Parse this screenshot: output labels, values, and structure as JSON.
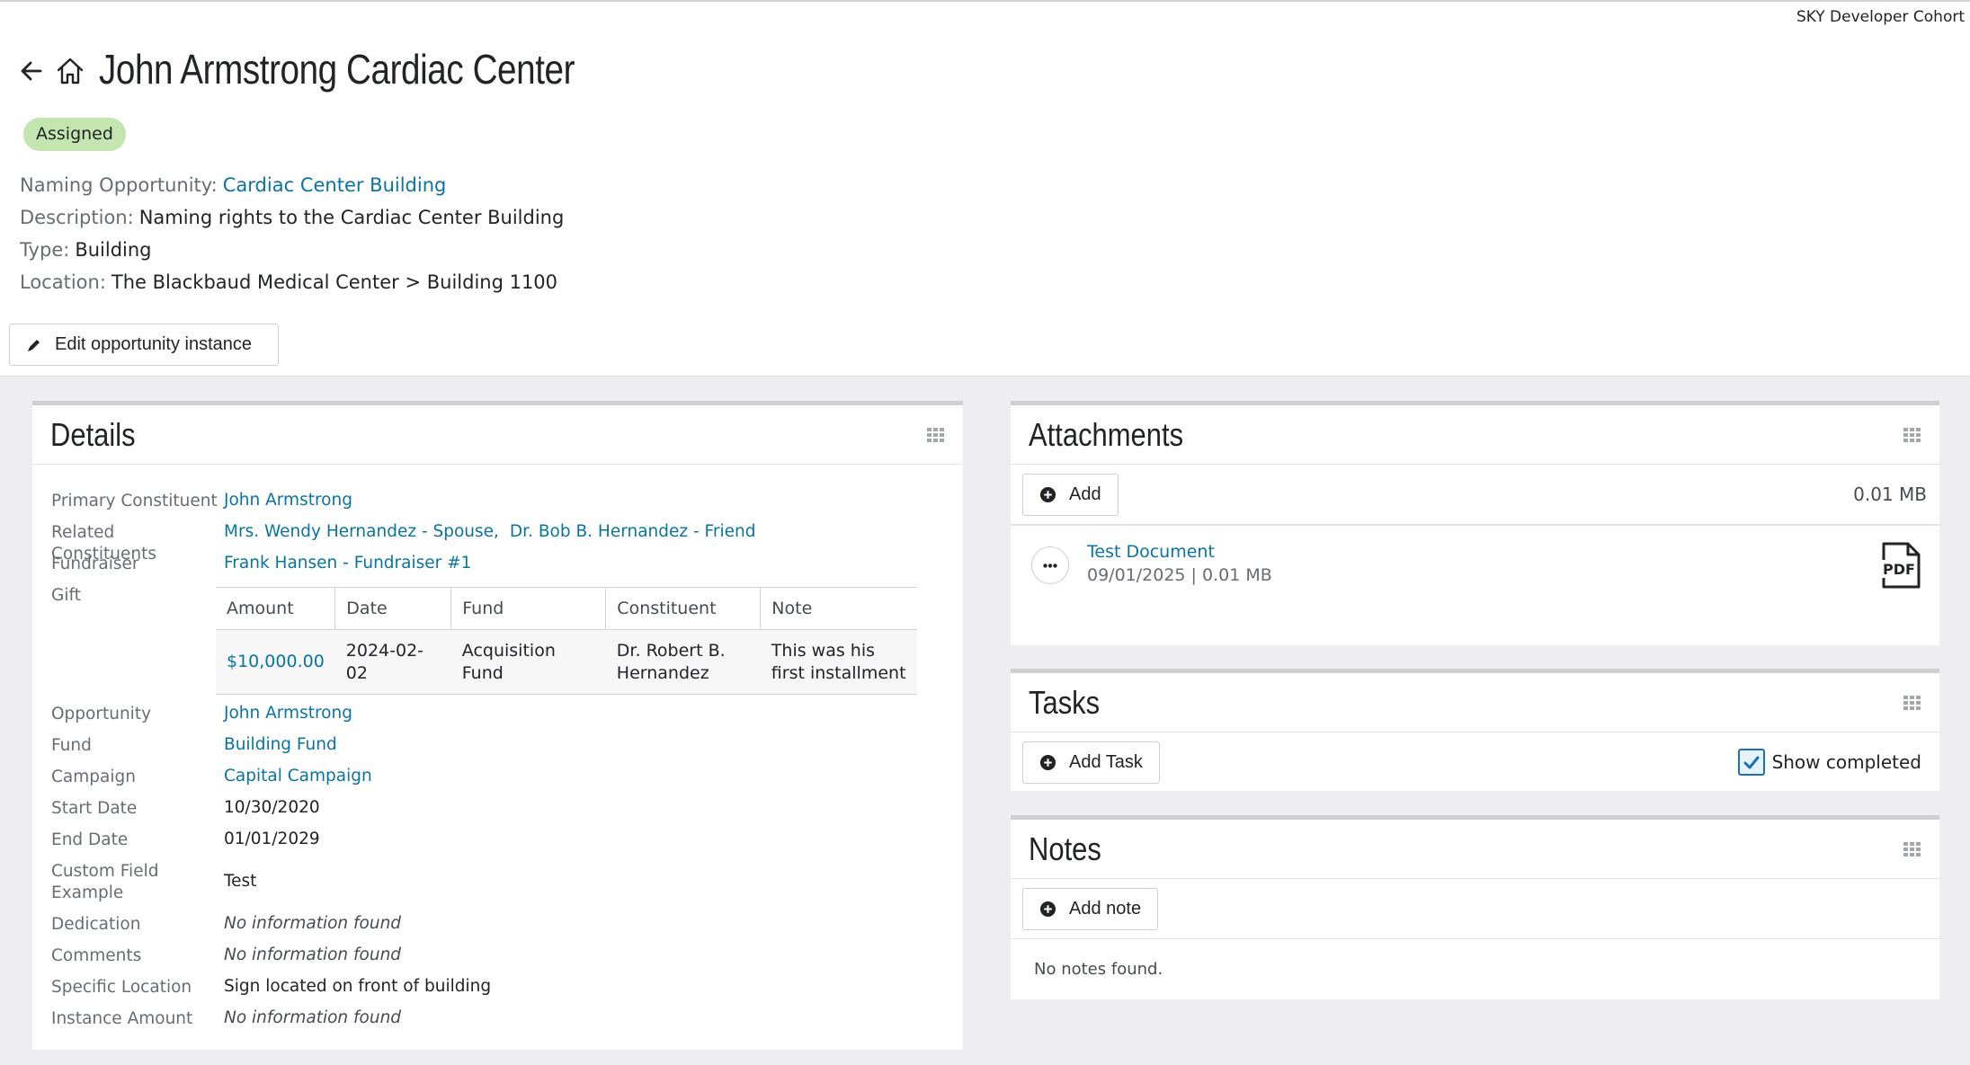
{
  "environment": "SKY Developer Cohort",
  "title": "John Armstrong Cardiac Center",
  "status": "Assigned",
  "meta": {
    "naming_opportunity_label": "Naming Opportunity:",
    "naming_opportunity_value": "Cardiac Center Building",
    "description_label": "Description:",
    "description_value": "Naming rights to the Cardiac Center Building",
    "type_label": "Type:",
    "type_value": "Building",
    "location_label": "Location:",
    "location_value": "The Blackbaud Medical Center > Building 1100"
  },
  "edit_button_label": "Edit opportunity instance",
  "details": {
    "title": "Details",
    "primary_constituent_label": "Primary Constituent",
    "primary_constituent_value": "John Armstrong",
    "related_constituents_label": "Related Constituents",
    "related_constituents": [
      "Mrs. Wendy Hernandez - Spouse,",
      "Dr. Bob B. Hernandez - Friend"
    ],
    "fundraiser_label": "Fundraiser",
    "fundraiser_value": "Frank Hansen - Fundraiser #1",
    "gift_label": "Gift",
    "gift_table": {
      "headers": [
        "Amount",
        "Date",
        "Fund",
        "Constituent",
        "Note"
      ],
      "row": [
        "$10,000.00",
        "2024-02-02",
        "Acquisition Fund",
        "Dr. Robert B. Hernandez",
        "This was his first installment"
      ]
    },
    "opportunity_label": "Opportunity",
    "opportunity_value": "John Armstrong",
    "fund_label": "Fund",
    "fund_value": "Building Fund",
    "campaign_label": "Campaign",
    "campaign_value": "Capital Campaign",
    "start_date_label": "Start Date",
    "start_date_value": "10/30/2020",
    "end_date_label": "End Date",
    "end_date_value": "01/01/2029",
    "custom_field_label": "Custom Field Example",
    "custom_field_value": "Test",
    "dedication_label": "Dedication",
    "dedication_value": "No information found",
    "comments_label": "Comments",
    "comments_value": "No information found",
    "specific_location_label": "Specific Location",
    "specific_location_value": "Sign located on front of building",
    "instance_amount_label": "Instance Amount",
    "instance_amount_value": "No information found"
  },
  "attachments": {
    "title": "Attachments",
    "add_label": "Add",
    "total_size": "0.01 MB",
    "item_name": "Test Document",
    "item_meta": "09/01/2025 | 0.01 MB",
    "file_type": "PDF"
  },
  "tasks": {
    "title": "Tasks",
    "add_label": "Add Task",
    "show_completed_label": "Show completed"
  },
  "notes": {
    "title": "Notes",
    "add_label": "Add note",
    "empty_text": "No notes found."
  }
}
